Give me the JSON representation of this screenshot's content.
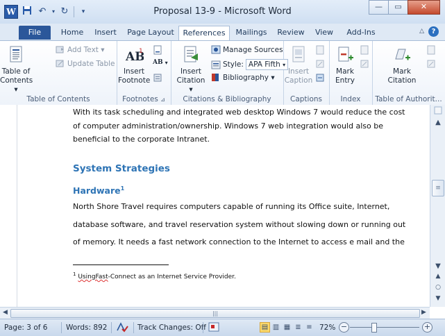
{
  "window": {
    "title": "Proposal 13-9 - Microsoft Word"
  },
  "qat": {
    "app_icon": "W"
  },
  "tabs": [
    "File",
    "Home",
    "Insert",
    "Page Layout",
    "References",
    "Mailings",
    "Review",
    "View",
    "Add-Ins"
  ],
  "active_tab": "References",
  "ribbon": {
    "toc": {
      "add_text": "Add Text ▾",
      "update_table": "Update Table",
      "big_l1": "Table of",
      "big_l2": "Contents ▾",
      "group_label": "Table of Contents"
    },
    "footnotes": {
      "big_l1": "Insert",
      "big_l2": "Footnote",
      "group_label": "Footnotes"
    },
    "citations": {
      "insert_l1": "Insert",
      "insert_l2": "Citation ▾",
      "manage_sources": "Manage Sources",
      "style_label": "Style:",
      "style_value": "APA Fifth",
      "bibliography": "Bibliography ▾",
      "group_label": "Citations & Bibliography"
    },
    "captions": {
      "big_l1": "Insert",
      "big_l2": "Caption",
      "group_label": "Captions"
    },
    "index": {
      "big_l1": "Mark",
      "big_l2": "Entry",
      "group_label": "Index"
    },
    "toa": {
      "big_l1": "Mark",
      "big_l2": "Citation",
      "group_label": "Table of Authorit..."
    }
  },
  "document": {
    "para1": [
      "With its task scheduling and integrated web desktop Windows 7 would reduce the cost",
      "of computer administration/ownership. Windows 7 web integration would also be",
      "beneficial to the corporate Intranet."
    ],
    "heading1": "System Strategies",
    "heading2": "Hardware",
    "heading2_sup": "1",
    "para2": [
      "North Shore Travel requires computers capable of running its Office suite, Internet,",
      "database software, and travel reservation system without slowing down or running out",
      "of memory. It needs a fast network connection to the Internet to access e mail and the"
    ],
    "footnote_num": "1",
    "footnote_word": "UsingFast",
    "footnote_rest": "-Connect as an Internet Service Provider."
  },
  "status": {
    "page": "Page: 3 of 6",
    "words": "Words: 892",
    "track_changes": "Track Changes: Off",
    "zoom": "72%"
  },
  "colors": {
    "heading": "#2e74b5",
    "file_tab": "#2b579a"
  }
}
